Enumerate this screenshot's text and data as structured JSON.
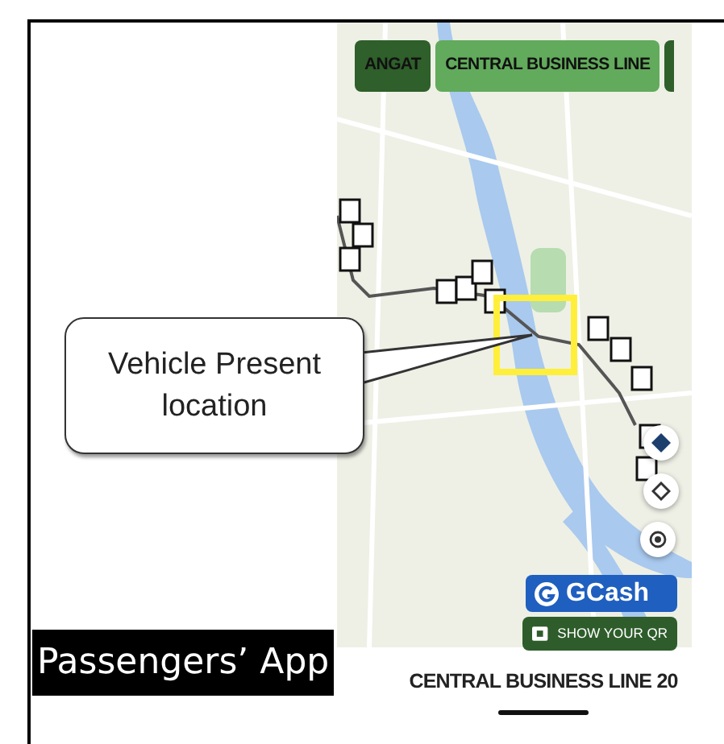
{
  "route_chips": [
    {
      "label": "ANGAT",
      "selected": true
    },
    {
      "label": "CENTRAL BUSINESS LINE",
      "selected": false
    }
  ],
  "callout": {
    "text": "Vehicle Present location"
  },
  "caption": "Passengers’ App",
  "gcash_button": {
    "label": "GCash"
  },
  "qr_button": {
    "label": "SHOW YOUR QR"
  },
  "bottom_sheet": {
    "title": "CENTRAL BUSINESS LINE 20"
  }
}
